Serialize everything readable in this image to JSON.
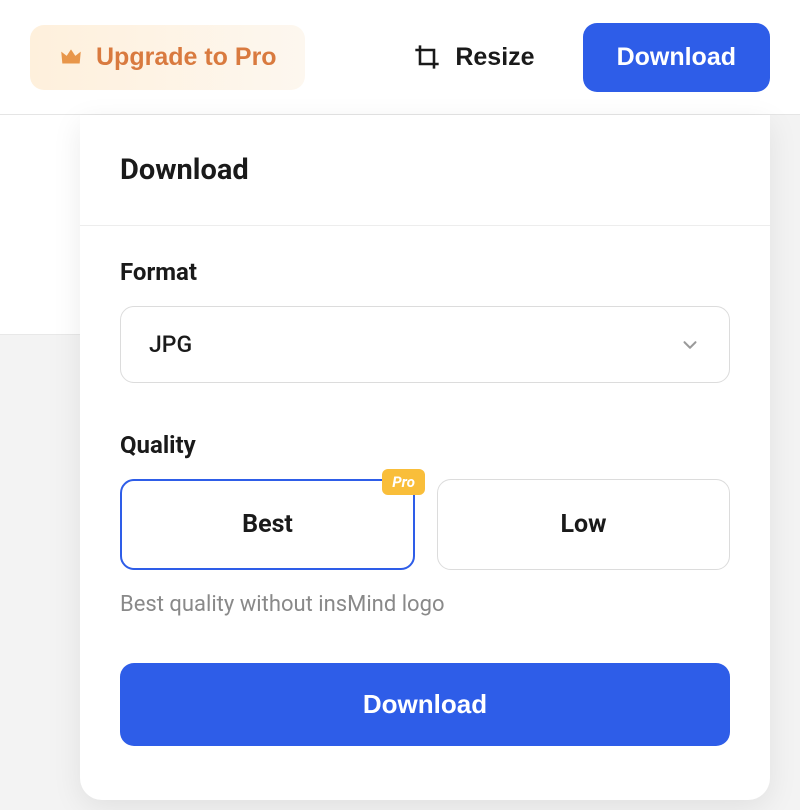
{
  "toolbar": {
    "upgrade_label": "Upgrade to Pro",
    "resize_label": "Resize",
    "download_label": "Download"
  },
  "panel": {
    "title": "Download",
    "format": {
      "label": "Format",
      "selected": "JPG"
    },
    "quality": {
      "label": "Quality",
      "options": [
        {
          "label": "Best",
          "selected": true,
          "pro_badge": "Pro"
        },
        {
          "label": "Low",
          "selected": false
        }
      ],
      "hint": "Best quality without insMind logo"
    },
    "download_button": "Download"
  }
}
